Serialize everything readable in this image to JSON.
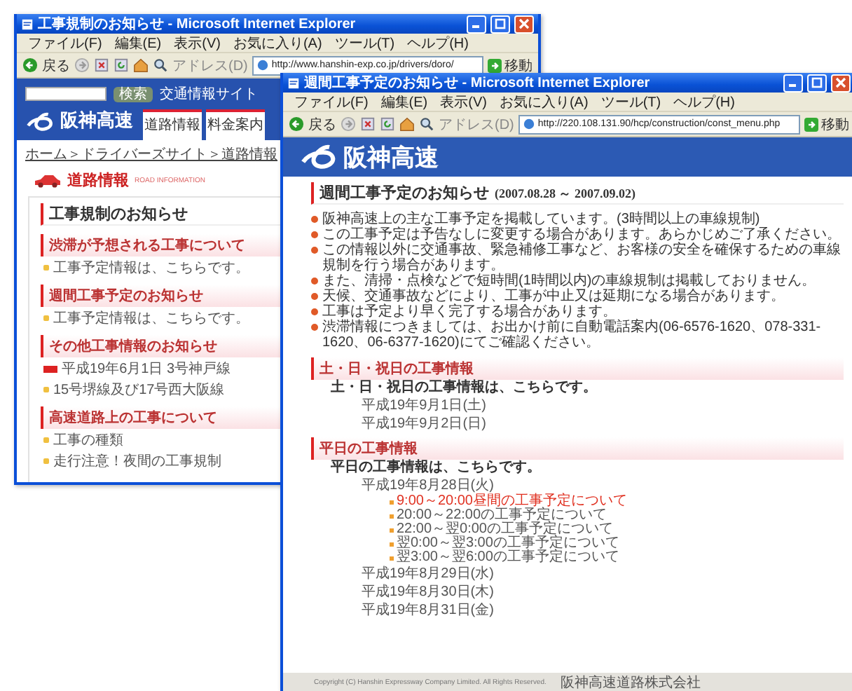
{
  "windows": [
    {
      "kind": "portal",
      "title": "工事規制のお知らせ - Microsoft Internet Explorer",
      "menu": [
        "ファイル(F)",
        "編集(E)",
        "表示(V)",
        "お気に入り(A)",
        "ツール(T)",
        "ヘルプ(H)"
      ],
      "toolbar": {
        "back": "戻る",
        "address_label": "アドレス(D)",
        "url": "http://www.hanshin-exp.co.jp/drivers/doro/",
        "go": "移動"
      },
      "page": {
        "search_button": "検索",
        "header_link": "交通情報サイト",
        "logo": "阪神高速",
        "tabs": [
          "道路情報",
          "料金案内"
        ],
        "breadcrumb": "ホーム＞ドライバーズサイト＞道路情報",
        "section_title": "道路情報",
        "section_subtitle": "ROAD INFORMATION",
        "heading": "工事規制のお知らせ",
        "groups": [
          {
            "title": "渋滞が予想される工事について",
            "items": [
              {
                "kind": "plain",
                "text": "工事予定情報は、こちらです。"
              }
            ]
          },
          {
            "title": "週間工事予定のお知らせ",
            "items": [
              {
                "kind": "plain",
                "text": "工事予定情報は、こちらです。"
              }
            ]
          },
          {
            "title": "その他工事情報のお知らせ",
            "items": [
              {
                "kind": "new",
                "text": "平成19年6月1日 3号神戸線"
              },
              {
                "kind": "plain",
                "text": "15号堺線及び17号西大阪線"
              }
            ]
          },
          {
            "title": "高速道路上の工事について",
            "items": [
              {
                "kind": "plain",
                "text": "工事の種類"
              },
              {
                "kind": "plain",
                "text": "走行注意！夜間の工事規制"
              }
            ]
          }
        ]
      }
    },
    {
      "kind": "schedule",
      "title": "週間工事予定のお知らせ - Microsoft Internet Explorer",
      "menu": [
        "ファイル(F)",
        "編集(E)",
        "表示(V)",
        "お気に入り(A)",
        "ツール(T)",
        "ヘルプ(H)"
      ],
      "toolbar": {
        "back": "戻る",
        "address_label": "アドレス(D)",
        "url": "http://220.108.131.90/hcp/construction/const_menu.php",
        "go": "移動"
      },
      "page": {
        "logo": "阪神高速",
        "heading": "週間工事予定のお知らせ",
        "period": "(2007.08.28 ～ 2007.09.02)",
        "notes": [
          "阪神高速上の主な工事予定を掲載しています。(3時間以上の車線規制)",
          "この工事予定は予告なしに変更する場合があります。あらかじめご了承ください。",
          "この情報以外に交通事故、緊急補修工事など、お客様の安全を確保するための車線規制を行う場合があります。",
          "また、清掃・点検などで短時間(1時間以内)の車線規制は掲載しておりません。",
          "天候、交通事故などにより、工事が中止又は延期になる場合があります。",
          "工事は予定より早く完了する場合があります。",
          "渋滞情報につきましては、お出かけ前に自動電話案内(06-6576-1620、078-331-1620、06-6377-1620)にてご確認ください。"
        ],
        "sections": [
          {
            "title": "土・日・祝日の工事情報",
            "lead": "土・日・祝日の工事情報は、こちらです。",
            "days": [
              {
                "label": "平成19年9月1日(土)"
              },
              {
                "label": "平成19年9月2日(日)"
              }
            ]
          },
          {
            "title": "平日の工事情報",
            "lead": "平日の工事情報は、こちらです。",
            "days": [
              {
                "label": "平成19年8月28日(火)",
                "links": [
                  {
                    "text": "9:00～20:00昼間の工事予定について",
                    "highlighted": true
                  },
                  {
                    "text": "20:00～22:00の工事予定について",
                    "highlighted": false
                  },
                  {
                    "text": "22:00～翌0:00の工事予定について",
                    "highlighted": false
                  },
                  {
                    "text": "翌0:00～翌3:00の工事予定について",
                    "highlighted": false
                  },
                  {
                    "text": "翌3:00～翌6:00の工事予定について",
                    "highlighted": false
                  }
                ]
              },
              {
                "label": "平成19年8月29日(水)"
              },
              {
                "label": "平成19年8月30日(木)"
              },
              {
                "label": "平成19年8月31日(金)"
              }
            ]
          }
        ],
        "footer": {
          "copyright": "Copyright (C) Hanshin Expressway Company Limited. All Rights Reserved.",
          "company": "阪神高速道路株式会社"
        }
      }
    }
  ]
}
